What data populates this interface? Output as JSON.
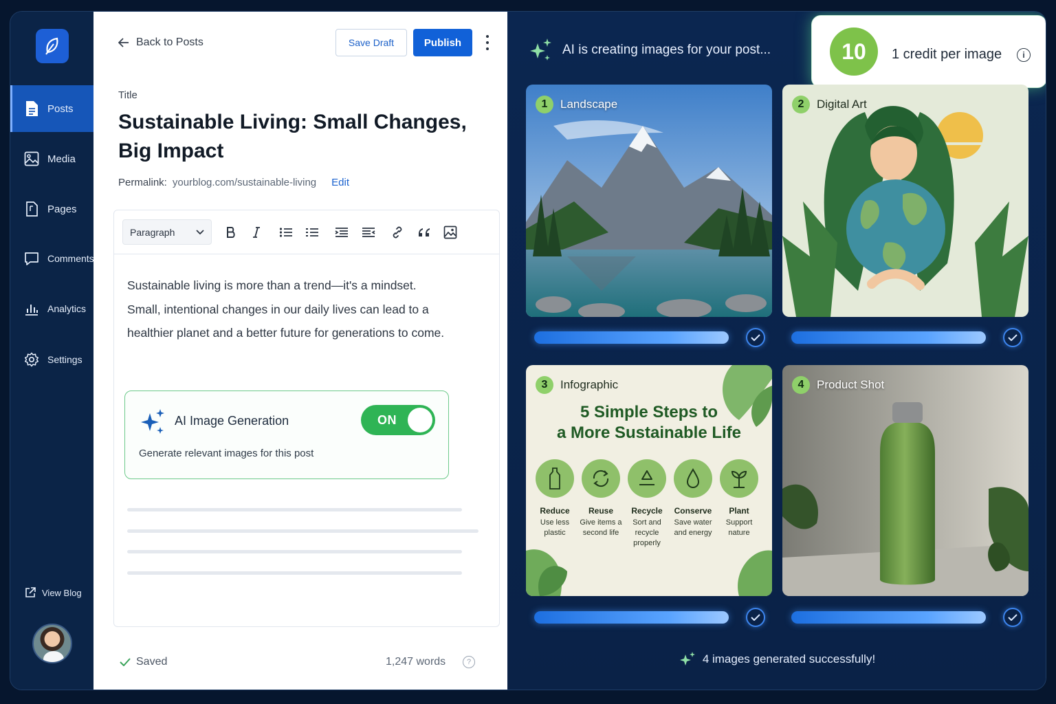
{
  "sidebar": {
    "items": [
      {
        "label": "Posts",
        "icon": "document-icon",
        "active": true
      },
      {
        "label": "Media",
        "icon": "image-icon"
      },
      {
        "label": "Pages",
        "icon": "pages-icon"
      },
      {
        "label": "Comments",
        "icon": "comment-icon"
      },
      {
        "label": "Analytics",
        "icon": "chart-icon"
      },
      {
        "label": "Settings",
        "icon": "gear-icon"
      }
    ],
    "view_blog": "View Blog"
  },
  "editor": {
    "back_label": "Back to Posts",
    "save_draft": "Save Draft",
    "publish": "Publish",
    "title_label": "Title",
    "title": "Sustainable Living: Small Changes, Big Impact",
    "permalink_label": "Permalink:",
    "permalink_url": "yourblog.com/sustainable-living",
    "permalink_edit": "Edit",
    "block_format": "Paragraph",
    "body": "Sustainable living is more than a trend—it's a mindset. Small, intentional changes in our daily lives can lead to a healthier planet and a better future for generations to come.",
    "ai_toggle": {
      "title": "AI Image Generation",
      "subtitle": "Generate relevant images for this post",
      "state": "ON"
    },
    "status": "Saved",
    "word_count": "1,247 words",
    "help": "?"
  },
  "generation": {
    "heading": "AI is creating images for your post...",
    "credits": {
      "count": "10",
      "label": "1 credit per image",
      "info": "i"
    },
    "cards": [
      {
        "number": "1",
        "label": "Landscape",
        "progress": 1.0
      },
      {
        "number": "2",
        "label": "Digital Art",
        "progress": 1.0
      },
      {
        "number": "3",
        "label": "Infographic",
        "progress": 1.0
      },
      {
        "number": "4",
        "label": "Product Shot",
        "progress": 1.0
      }
    ],
    "infographic": {
      "title_line1": "5 Simple Steps to",
      "title_line2": "a More Sustainable Life",
      "steps": [
        {
          "name": "Reduce",
          "desc": "Use less plastic",
          "icon": "bottle-icon"
        },
        {
          "name": "Reuse",
          "desc": "Give items a second life",
          "icon": "cycle-icon"
        },
        {
          "name": "Recycle",
          "desc": "Sort and recycle properly",
          "icon": "recycle-icon"
        },
        {
          "name": "Conserve",
          "desc": "Save water and energy",
          "icon": "water-drop-icon"
        },
        {
          "name": "Plant",
          "desc": "Support nature",
          "icon": "plant-icon"
        }
      ]
    },
    "success": "4 images generated successfully!"
  },
  "colors": {
    "accent": "#1161d8",
    "toggle_on": "#2fb455",
    "credit_badge": "#7ec24a",
    "panel_bg": "#0a2247"
  }
}
